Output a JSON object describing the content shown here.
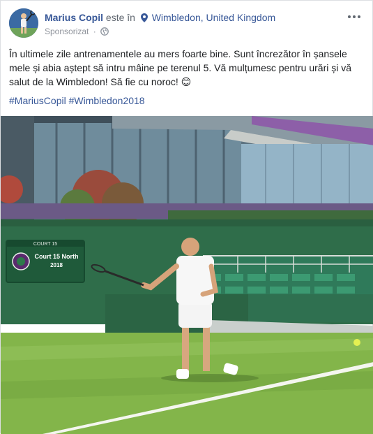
{
  "post": {
    "author": "Marius Copil",
    "verb": "este în",
    "location": "Wimbledon, United Kingdom",
    "meta_label": "Sponsorizat",
    "separator": "·",
    "body": "În ultimele zile antrenamentele au mers foarte bine. Sunt încrezător în șansele mele și abia aștept să intru mâine pe terenul 5. Vă mulțumesc pentru urări și vă salut de la Wimbledon! Să fie cu noroc! 😊",
    "hashtags": [
      "#MariusCopil",
      "#Wimbledon2018"
    ]
  },
  "photo": {
    "scoreboard_court": "COURT 15",
    "scoreboard_line1": "Court 15 North",
    "scoreboard_line2": "2018"
  },
  "icons": {
    "location": "map-pin-icon",
    "audience": "globe-icon",
    "options": "more-options-icon"
  },
  "colors": {
    "link": "#385898",
    "text": "#1c1e21",
    "meta": "#90949c",
    "grass": "#83b54a",
    "wall": "#2f6d4a"
  }
}
